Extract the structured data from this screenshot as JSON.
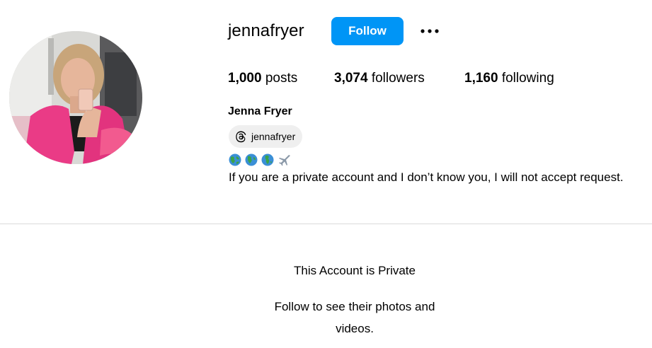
{
  "profile": {
    "username": "jennafryer",
    "follow_label": "Follow",
    "more_icon": "more-horizontal-icon",
    "full_name": "Jenna Fryer"
  },
  "stats": {
    "posts_count": "1,000",
    "posts_label": "posts",
    "followers_count": "3,074",
    "followers_label": "followers",
    "following_count": "1,160",
    "following_label": "following"
  },
  "bio": {
    "threads_handle": "jennafryer",
    "threads_icon": "threads-icon",
    "emojis": [
      "globe-icon",
      "globe-icon",
      "globe-icon",
      "airplane-icon"
    ],
    "text": "If you are a private account and I don’t know you, I will not accept request."
  },
  "private_notice": {
    "title": "This Account is Private",
    "subtitle": "Follow to see their photos and videos."
  },
  "colors": {
    "follow_button": "#0095f6",
    "chip_background": "#efefef",
    "divider": "#dbdbdb"
  }
}
